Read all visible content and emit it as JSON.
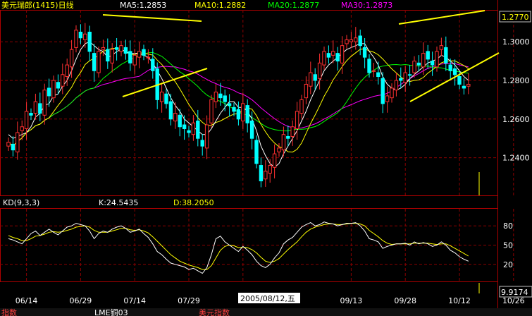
{
  "header": {
    "title": "美元瑞郎(1415)日线",
    "ma5": "MA5:1.2853",
    "ma10": "MA10:1.2882",
    "ma20": "MA20:1.2877",
    "ma30": "MA30:1.2873"
  },
  "kd_header": {
    "name": "KD(9,3,3)",
    "k": "K:24.5435",
    "d": "D:38.2050"
  },
  "cursor": {
    "date_label": "2005/08/12,五",
    "value_label": "9.9174"
  },
  "bottom_tabs": [
    "指数",
    "LME铜03",
    "美元指数"
  ],
  "colors": {
    "background": "#000000",
    "grid": "#8b0000",
    "up_candle": "#ff3030",
    "down_candle": "#00ffff",
    "ma5": "#ffffff",
    "ma10": "#ffff00",
    "ma20": "#00ff00",
    "ma30": "#ff00ff",
    "trendline": "#ffff00",
    "k_line": "#ffffff",
    "d_line": "#ffff00"
  },
  "chart_data": [
    {
      "type": "candlestick",
      "title": "美元瑞郎(1415)日线",
      "x_tick_labels": [
        "06/14",
        "06/29",
        "07/14",
        "07/29",
        "08",
        "09/13",
        "09/28",
        "10/12",
        "10/26"
      ],
      "x_tick_index": [
        4,
        16,
        28,
        40,
        52,
        76,
        88,
        100,
        112
      ],
      "y_ticks": [
        1.24,
        1.26,
        1.28,
        1.3
      ],
      "y_labels": [
        "1.2400",
        "1.2600",
        "1.2800",
        "1.3000"
      ],
      "y_top_label": "1.2770",
      "ylim": [
        1.2205,
        1.3165
      ],
      "series_close": [
        1.248,
        1.244,
        1.253,
        1.256,
        1.264,
        1.262,
        1.269,
        1.263,
        1.275,
        1.272,
        1.28,
        1.276,
        1.283,
        1.288,
        1.296,
        1.306,
        1.302,
        1.304,
        1.295,
        1.285,
        1.295,
        1.297,
        1.29,
        1.296,
        1.296,
        1.298,
        1.294,
        1.289,
        1.293,
        1.295,
        1.293,
        1.292,
        1.285,
        1.27,
        1.274,
        1.268,
        1.26,
        1.263,
        1.256,
        1.255,
        1.253,
        1.258,
        1.25,
        1.246,
        1.257,
        1.27,
        1.274,
        1.271,
        1.269,
        1.267,
        1.264,
        1.26,
        1.268,
        1.258,
        1.25,
        1.237,
        1.228,
        1.233,
        1.236,
        1.242,
        1.245,
        1.252,
        1.25,
        1.256,
        1.264,
        1.27,
        1.278,
        1.284,
        1.28,
        1.289,
        1.295,
        1.292,
        1.295,
        1.29,
        1.298,
        1.301,
        1.301,
        1.302,
        1.298,
        1.292,
        1.284,
        1.285,
        1.282,
        1.268,
        1.272,
        1.276,
        1.28,
        1.28,
        1.284,
        1.283,
        1.29,
        1.288,
        1.294,
        1.291,
        1.288,
        1.295,
        1.298,
        1.289,
        1.285,
        1.283,
        1.278,
        1.276,
        1.278
      ],
      "series_ma5": [
        1.252,
        1.25,
        1.251,
        1.252,
        1.253,
        1.256,
        1.261,
        1.263,
        1.267,
        1.268,
        1.272,
        1.273,
        1.277,
        1.28,
        1.285,
        1.291,
        1.296,
        1.299,
        1.3,
        1.298,
        1.296,
        1.295,
        1.292,
        1.293,
        1.295,
        1.296,
        1.295,
        1.294,
        1.294,
        1.294,
        1.293,
        1.292,
        1.289,
        1.285,
        1.281,
        1.276,
        1.271,
        1.267,
        1.264,
        1.26,
        1.258,
        1.256,
        1.254,
        1.252,
        1.252,
        1.255,
        1.259,
        1.263,
        1.266,
        1.269,
        1.269,
        1.266,
        1.266,
        1.264,
        1.26,
        1.254,
        1.246,
        1.241,
        1.237,
        1.235,
        1.237,
        1.242,
        1.246,
        1.25,
        1.254,
        1.259,
        1.264,
        1.27,
        1.275,
        1.28,
        1.285,
        1.288,
        1.29,
        1.292,
        1.294,
        1.296,
        1.297,
        1.298,
        1.299,
        1.299,
        1.295,
        1.292,
        1.288,
        1.282,
        1.278,
        1.276,
        1.275,
        1.276,
        1.278,
        1.281,
        1.283,
        1.285,
        1.287,
        1.289,
        1.29,
        1.291,
        1.293,
        1.292,
        1.29,
        1.288,
        1.285,
        1.282,
        1.28
      ]
    },
    {
      "type": "line",
      "title": "KD(9,3,3)",
      "y_ticks": [
        20,
        50,
        80
      ],
      "ylim": [
        0,
        100
      ],
      "series": [
        {
          "name": "K",
          "values": [
            60,
            58,
            55,
            52,
            60,
            68,
            72,
            65,
            70,
            75,
            70,
            66,
            72,
            78,
            80,
            84,
            82,
            80,
            72,
            60,
            68,
            72,
            70,
            75,
            78,
            80,
            76,
            70,
            72,
            75,
            68,
            62,
            52,
            40,
            35,
            28,
            22,
            20,
            18,
            16,
            12,
            14,
            10,
            6,
            15,
            35,
            60,
            64,
            55,
            50,
            45,
            40,
            48,
            42,
            35,
            25,
            18,
            15,
            20,
            30,
            38,
            52,
            58,
            62,
            70,
            78,
            82,
            85,
            80,
            82,
            86,
            84,
            83,
            80,
            82,
            84,
            84,
            85,
            80,
            72,
            60,
            58,
            55,
            45,
            48,
            50,
            52,
            52,
            53,
            50,
            55,
            52,
            54,
            52,
            48,
            50,
            55,
            50,
            42,
            38,
            32,
            28,
            25
          ]
        },
        {
          "name": "D",
          "values": [
            65,
            62,
            60,
            57,
            57,
            60,
            64,
            65,
            67,
            70,
            71,
            70,
            71,
            73,
            75,
            78,
            79,
            80,
            78,
            73,
            70,
            70,
            70,
            72,
            74,
            76,
            76,
            74,
            73,
            74,
            72,
            69,
            63,
            56,
            49,
            42,
            35,
            30,
            25,
            22,
            19,
            17,
            15,
            12,
            12,
            18,
            30,
            42,
            48,
            50,
            49,
            46,
            47,
            46,
            43,
            38,
            31,
            25,
            23,
            25,
            29,
            36,
            43,
            49,
            55,
            63,
            70,
            75,
            78,
            80,
            82,
            83,
            83,
            82,
            82,
            83,
            84,
            84,
            83,
            80,
            73,
            68,
            63,
            57,
            53,
            51,
            52,
            52,
            52,
            52,
            53,
            53,
            53,
            53,
            52,
            51,
            52,
            52,
            49,
            45,
            41,
            37,
            33
          ]
        }
      ]
    }
  ]
}
